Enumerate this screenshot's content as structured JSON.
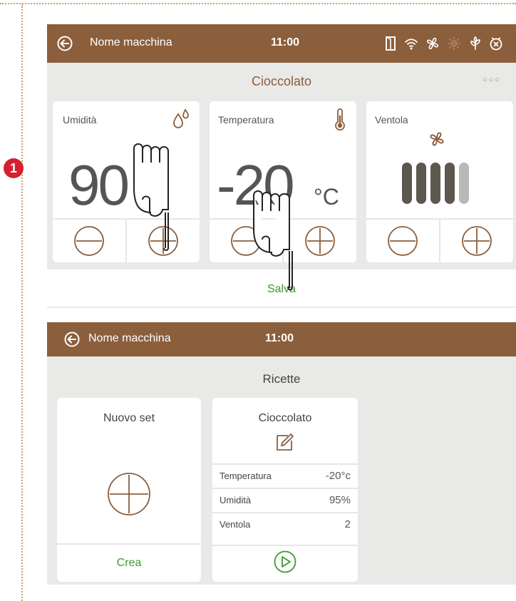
{
  "marker": "1",
  "screen1": {
    "header": {
      "machine_name": "Nome macchina",
      "time": "11:00"
    },
    "status_icons": [
      "door-icon",
      "wifi-icon",
      "fan-icon",
      "defrost-icon",
      "plant-icon",
      "alarm-icon"
    ],
    "recipe_title": "Cioccolato",
    "more_label": "○○○",
    "humidity": {
      "label": "Umidità",
      "value": "90"
    },
    "temperature": {
      "label": "Temperatura",
      "value": "-20",
      "unit": "°C"
    },
    "fan": {
      "label": "Ventola",
      "level": 4,
      "max_level": 5
    },
    "save_label": "Salva"
  },
  "screen2": {
    "header": {
      "machine_name": "Nome macchina",
      "time": "11:00"
    },
    "title": "Ricette",
    "new_set": {
      "title": "Nuovo set",
      "action": "Crea"
    },
    "recipe": {
      "title": "Cioccolato",
      "rows": [
        {
          "label": "Temperatura",
          "value": "-20°c"
        },
        {
          "label": "Umidità",
          "value": "95%"
        },
        {
          "label": "Ventola",
          "value": "2"
        }
      ]
    }
  },
  "colors": {
    "header_brown": "#8b5e3c",
    "accent_brown": "#8b5e3c",
    "action_green": "#3c9a2c",
    "marker_red": "#d61f2f"
  }
}
